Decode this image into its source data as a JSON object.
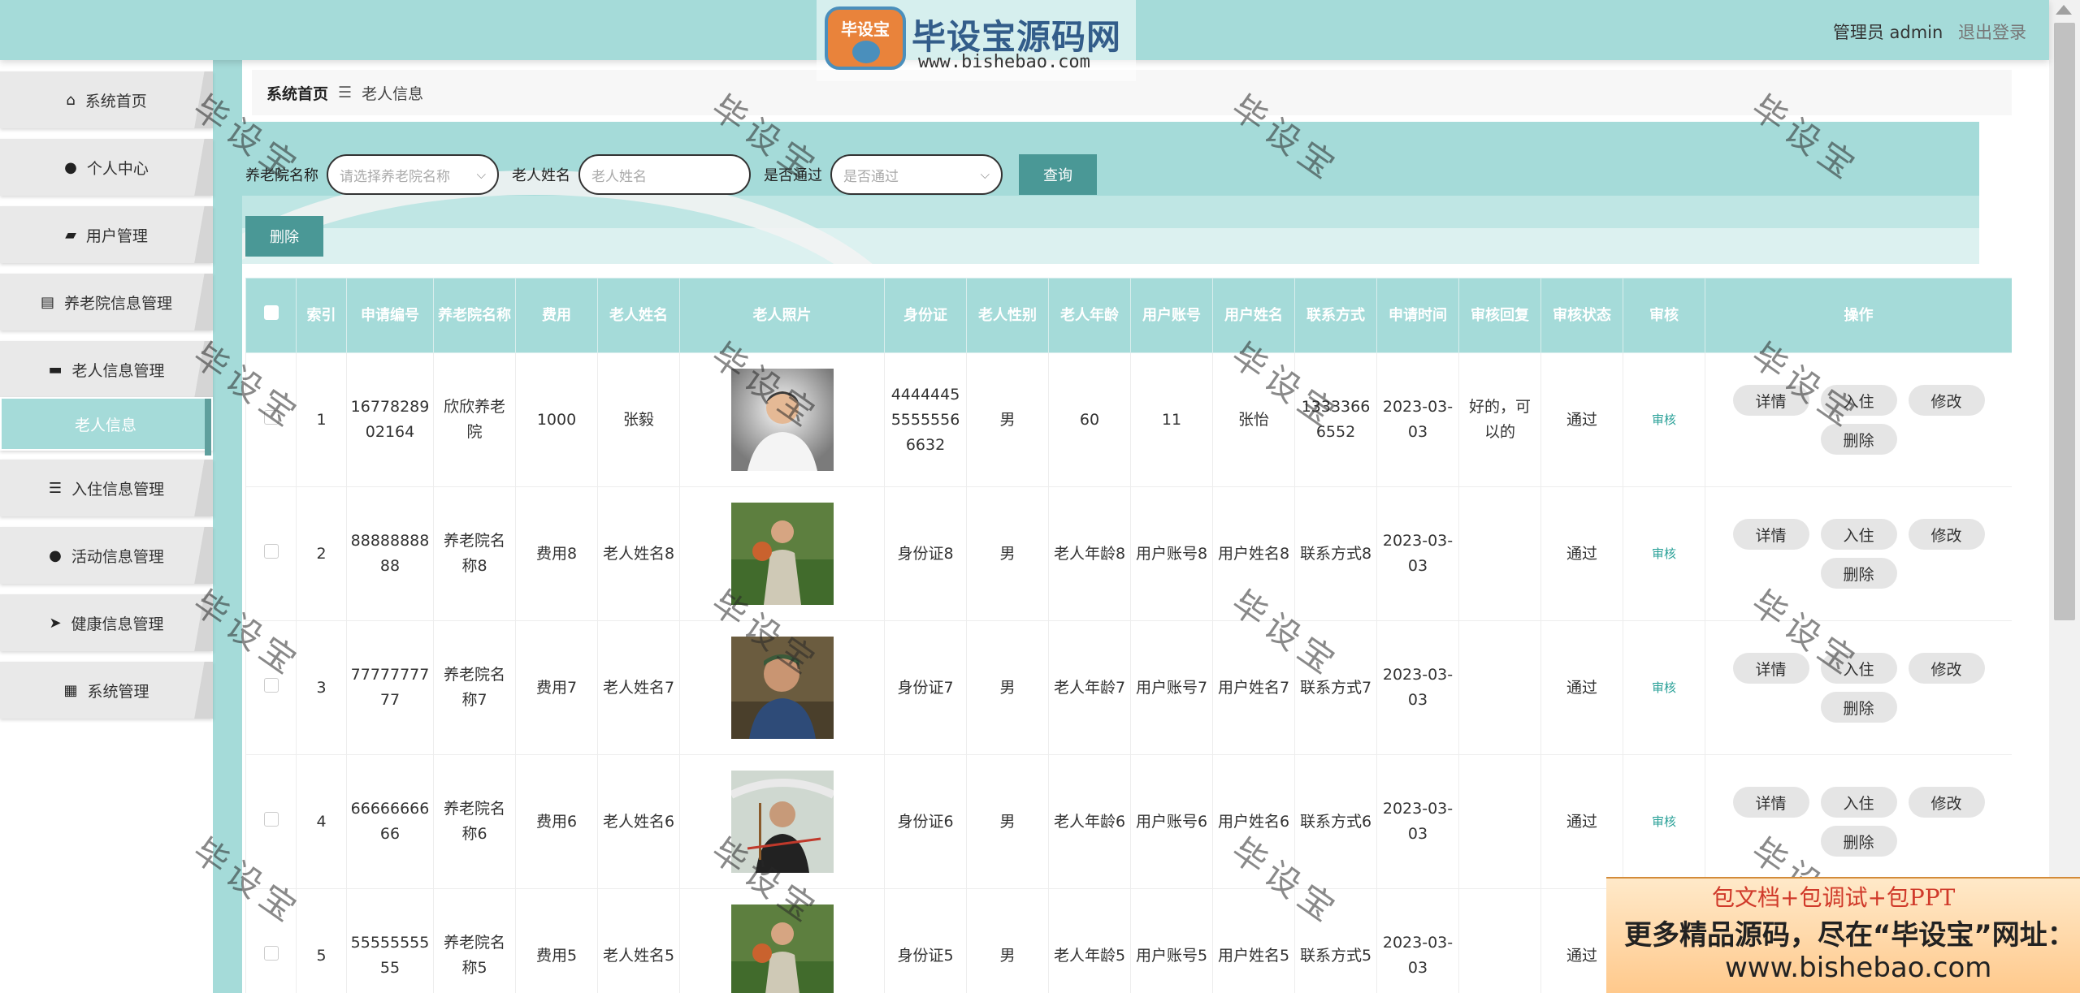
{
  "logo": {
    "badge": "毕设宝",
    "title": "毕设宝源码网",
    "url": "www.bishebao.com"
  },
  "user": {
    "role_name": "管理员 admin",
    "logout": "退出登录"
  },
  "sidebar": {
    "items": [
      {
        "label": "系统首页",
        "icon": "⌂"
      },
      {
        "label": "个人中心",
        "icon": "●"
      },
      {
        "label": "用户管理",
        "icon": "▰"
      },
      {
        "label": "养老院信息管理",
        "icon": "▤"
      },
      {
        "label": "老人信息管理",
        "icon": "▬"
      },
      {
        "label": "老人信息",
        "icon": ""
      },
      {
        "label": "入住信息管理",
        "icon": "☰"
      },
      {
        "label": "活动信息管理",
        "icon": "●"
      },
      {
        "label": "健康信息管理",
        "icon": "➤"
      },
      {
        "label": "系统管理",
        "icon": "▦"
      }
    ]
  },
  "breadcrumb": {
    "home": "系统首页",
    "sep": "☰",
    "current": "老人信息"
  },
  "search": {
    "nursing_home_label": "养老院名称",
    "nursing_home_placeholder": "请选择养老院名称",
    "elder_name_label": "老人姓名",
    "elder_name_placeholder": "老人姓名",
    "approved_label": "是否通过",
    "approved_placeholder": "是否通过",
    "query_button": "查询",
    "delete_button": "删除"
  },
  "table": {
    "headers": [
      "",
      "索引",
      "申请编号",
      "养老院名称",
      "费用",
      "老人姓名",
      "老人照片",
      "身份证",
      "老人性别",
      "老人年龄",
      "用户账号",
      "用户姓名",
      "联系方式",
      "申请时间",
      "审核回复",
      "审核状态",
      "审核",
      "操作"
    ],
    "audit_label": "审核",
    "op_labels": {
      "detail": "详情",
      "checkin": "入住",
      "edit": "修改",
      "delete": "删除"
    },
    "rows": [
      {
        "index": "1",
        "app_no": "1677828902164",
        "home": "欣欣养老院",
        "fee": "1000",
        "name": "张毅",
        "id_card": "444444555555566632",
        "gender": "男",
        "age": "60",
        "account": "11",
        "user_name": "张怡",
        "contact": "13333666552",
        "apply_time": "2023-03-03",
        "reply": "好的，可以的",
        "status": "通过",
        "photo": "doctor"
      },
      {
        "index": "2",
        "app_no": "8888888888",
        "home": "养老院名称8",
        "fee": "费用8",
        "name": "老人姓名8",
        "id_card": "身份证8",
        "gender": "男",
        "age": "老人年龄8",
        "account": "用户账号8",
        "user_name": "用户姓名8",
        "contact": "联系方式8",
        "apply_time": "2023-03-03",
        "reply": "",
        "status": "通过",
        "photo": "basketball"
      },
      {
        "index": "3",
        "app_no": "7777777777",
        "home": "养老院名称7",
        "fee": "费用7",
        "name": "老人姓名7",
        "id_card": "身份证7",
        "gender": "男",
        "age": "老人年龄7",
        "account": "用户账号7",
        "user_name": "用户姓名7",
        "contact": "联系方式7",
        "apply_time": "2023-03-03",
        "reply": "",
        "status": "通过",
        "photo": "smile"
      },
      {
        "index": "4",
        "app_no": "6666666666",
        "home": "养老院名称6",
        "fee": "费用6",
        "name": "老人姓名6",
        "id_card": "身份证6",
        "gender": "男",
        "age": "老人年龄6",
        "account": "用户账号6",
        "user_name": "用户姓名6",
        "contact": "联系方式6",
        "apply_time": "2023-03-03",
        "reply": "",
        "status": "通过",
        "photo": "erhu"
      },
      {
        "index": "5",
        "app_no": "5555555555",
        "home": "养老院名称5",
        "fee": "费用5",
        "name": "老人姓名5",
        "id_card": "身份证5",
        "gender": "男",
        "age": "老人年龄5",
        "account": "用户账号5",
        "user_name": "用户姓名5",
        "contact": "联系方式5",
        "apply_time": "2023-03-03",
        "reply": "",
        "status": "通过",
        "photo": "basketball"
      }
    ]
  },
  "watermark": "毕设宝",
  "ad": {
    "line1": "包文档+包调试+包PPT",
    "line2": "更多精品源码，尽在“毕设宝”网址：",
    "line3": "www.bishebao.com"
  }
}
